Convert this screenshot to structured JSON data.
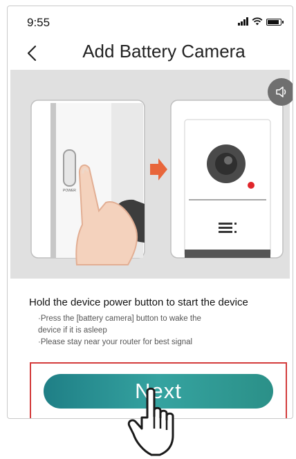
{
  "status_bar": {
    "time": "9:55"
  },
  "nav": {
    "title": "Add Battery Camera"
  },
  "illustration": {
    "power_label": "POWER"
  },
  "instructions": {
    "title": "Hold the device power button to start the device",
    "lines": [
      "·Press the [battery camera] button to wake  the",
      "device if it is asleep",
      "·Please stay near your router for best signal"
    ]
  },
  "next_button": {
    "label": "Next"
  },
  "colors": {
    "button": "#2e9a97",
    "highlight": "#d33a3a",
    "arrow": "#e8663b",
    "record_dot": "#e0262b"
  }
}
